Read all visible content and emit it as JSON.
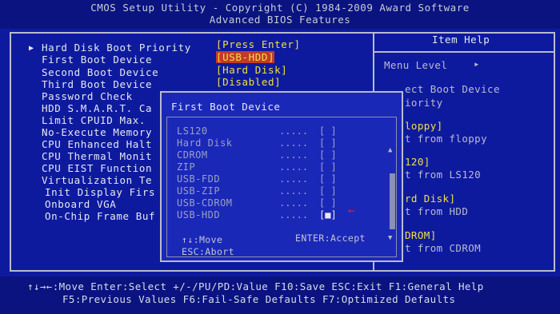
{
  "header": {
    "line1": "CMOS Setup Utility - Copyright (C) 1984-2009 Award Software",
    "line2": "Advanced BIOS Features"
  },
  "settings": [
    {
      "label": "Hard Disk Boot Priority",
      "value": "[Press Enter]"
    },
    {
      "label": "First Boot Device",
      "value": "[USB-HDD]"
    },
    {
      "label": "Second Boot Device",
      "value": "[Hard Disk]"
    },
    {
      "label": "Third Boot Device",
      "value": "[Disabled]"
    },
    {
      "label": "Password Check"
    },
    {
      "label": "HDD S.M.A.R.T. Ca"
    },
    {
      "label": "Limit CPUID Max."
    },
    {
      "label": "No-Execute Memory"
    },
    {
      "label": "CPU Enhanced Halt"
    },
    {
      "label": "CPU Thermal Monit"
    },
    {
      "label": "CPU EIST Function"
    },
    {
      "label": "Virtualization Te"
    },
    {
      "label": "Init Display Firs"
    },
    {
      "label": "Onboard VGA"
    },
    {
      "label": "On-Chip Frame Buf"
    }
  ],
  "help": {
    "title": "Item Help",
    "menu_level": "Menu Level",
    "menu_level_arrow": "▸",
    "lines": [
      "ect Boot Device",
      "iority",
      "loppy]",
      "t from floppy",
      "120]",
      "t from LS120",
      "rd Disk]",
      "t from HDD",
      "DROM]",
      "t from CDROM"
    ]
  },
  "popup": {
    "title": "First Boot Device",
    "options": [
      {
        "label": "LS120",
        "dots": ".....",
        "mark": "[ ]"
      },
      {
        "label": "Hard Disk",
        "dots": ".....",
        "mark": "[ ]"
      },
      {
        "label": "CDROM",
        "dots": ".....",
        "mark": "[ ]"
      },
      {
        "label": "ZIP",
        "dots": ".....",
        "mark": "[ ]"
      },
      {
        "label": "USB-FDD",
        "dots": ".....",
        "mark": "[ ]"
      },
      {
        "label": "USB-ZIP",
        "dots": ".....",
        "mark": "[ ]"
      },
      {
        "label": "USB-CDROM",
        "dots": ".....",
        "mark": "[ ]"
      },
      {
        "label": "USB-HDD",
        "dots": ".....",
        "mark": "[■]"
      }
    ],
    "hint_move": "↑↓:Move",
    "hint_accept": "ENTER:Accept",
    "hint_abort": "ESC:Abort",
    "scroll_up": "▲",
    "scroll_down": "▼",
    "pointer": "←"
  },
  "footer": {
    "line1": "↑↓→←:Move  Enter:Select  +/-/PU/PD:Value  F10:Save  ESC:Exit  F1:General Help",
    "line2": "F5:Previous Values  F6:Fail-Safe Defaults  F7:Optimized Defaults"
  },
  "colors": {
    "background": "#0e1a9e",
    "value_text": "#f0e040",
    "selected_value_bg": "#c23a2a",
    "pointer_arrow": "#e02020"
  }
}
